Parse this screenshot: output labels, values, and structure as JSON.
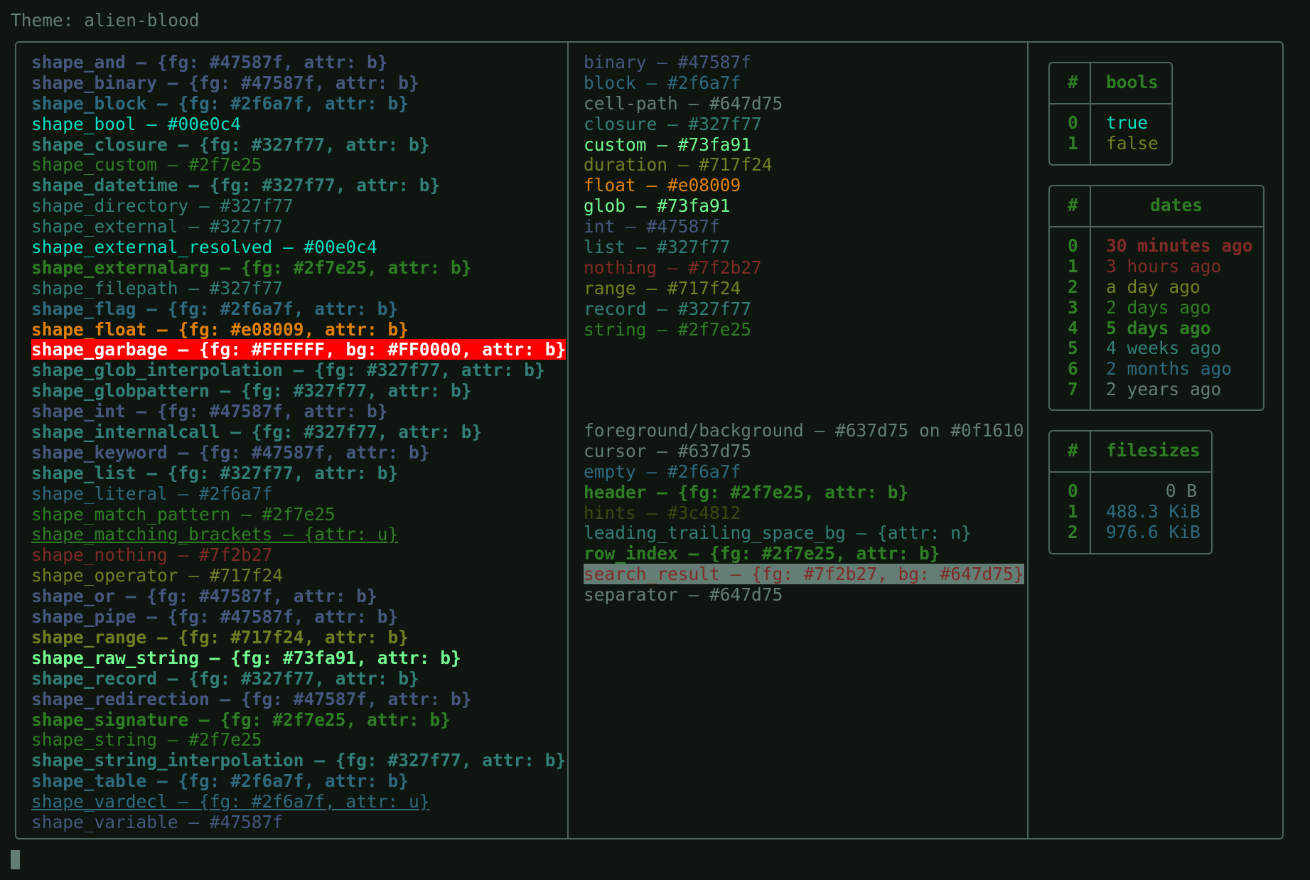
{
  "theme_line": "Theme: alien-blood",
  "shapes": [
    {
      "text": "shape_and – {fg: #47587f, attr: b}",
      "fg": "#47587f",
      "bold": true
    },
    {
      "text": "shape_binary – {fg: #47587f, attr: b}",
      "fg": "#47587f",
      "bold": true
    },
    {
      "text": "shape_block – {fg: #2f6a7f, attr: b}",
      "fg": "#2f6a7f",
      "bold": true
    },
    {
      "text": "shape_bool – #00e0c4",
      "fg": "#00e0c4"
    },
    {
      "text": "shape_closure – {fg: #327f77, attr: b}",
      "fg": "#327f77",
      "bold": true
    },
    {
      "text": "shape_custom – #2f7e25",
      "fg": "#2f7e25"
    },
    {
      "text": "shape_datetime – {fg: #327f77, attr: b}",
      "fg": "#327f77",
      "bold": true
    },
    {
      "text": "shape_directory – #327f77",
      "fg": "#327f77"
    },
    {
      "text": "shape_external – #327f77",
      "fg": "#327f77"
    },
    {
      "text": "shape_external_resolved – #00e0c4",
      "fg": "#00e0c4"
    },
    {
      "text": "shape_externalarg – {fg: #2f7e25, attr: b}",
      "fg": "#2f7e25",
      "bold": true
    },
    {
      "text": "shape_filepath – #327f77",
      "fg": "#327f77"
    },
    {
      "text": "shape_flag – {fg: #2f6a7f, attr: b}",
      "fg": "#2f6a7f",
      "bold": true
    },
    {
      "text": "shape_float – {fg: #e08009, attr: b}",
      "fg": "#e08009",
      "bold": true
    },
    {
      "text": "shape_garbage – {fg: #FFFFFF, bg: #FF0000, attr: b}",
      "fg": "#FFFFFF",
      "bg": "#FF0000",
      "bold": true
    },
    {
      "text": "shape_glob_interpolation – {fg: #327f77, attr: b}",
      "fg": "#327f77",
      "bold": true
    },
    {
      "text": "shape_globpattern – {fg: #327f77, attr: b}",
      "fg": "#327f77",
      "bold": true
    },
    {
      "text": "shape_int – {fg: #47587f, attr: b}",
      "fg": "#47587f",
      "bold": true
    },
    {
      "text": "shape_internalcall – {fg: #327f77, attr: b}",
      "fg": "#327f77",
      "bold": true
    },
    {
      "text": "shape_keyword – {fg: #47587f, attr: b}",
      "fg": "#47587f",
      "bold": true
    },
    {
      "text": "shape_list – {fg: #327f77, attr: b}",
      "fg": "#327f77",
      "bold": true
    },
    {
      "text": "shape_literal – #2f6a7f",
      "fg": "#2f6a7f"
    },
    {
      "text": "shape_match_pattern – #2f7e25",
      "fg": "#2f7e25"
    },
    {
      "text": "shape_matching_brackets – {attr: u}",
      "fg": "#2f7e25",
      "underline": true
    },
    {
      "text": "shape_nothing – #7f2b27",
      "fg": "#7f2b27"
    },
    {
      "text": "shape_operator – #717f24",
      "fg": "#717f24"
    },
    {
      "text": "shape_or – {fg: #47587f, attr: b}",
      "fg": "#47587f",
      "bold": true
    },
    {
      "text": "shape_pipe – {fg: #47587f, attr: b}",
      "fg": "#47587f",
      "bold": true
    },
    {
      "text": "shape_range – {fg: #717f24, attr: b}",
      "fg": "#717f24",
      "bold": true
    },
    {
      "text": "shape_raw_string – {fg: #73fa91, attr: b}",
      "fg": "#73fa91",
      "bold": true
    },
    {
      "text": "shape_record – {fg: #327f77, attr: b}",
      "fg": "#327f77",
      "bold": true
    },
    {
      "text": "shape_redirection – {fg: #47587f, attr: b}",
      "fg": "#47587f",
      "bold": true
    },
    {
      "text": "shape_signature – {fg: #2f7e25, attr: b}",
      "fg": "#2f7e25",
      "bold": true
    },
    {
      "text": "shape_string – #2f7e25",
      "fg": "#2f7e25"
    },
    {
      "text": "shape_string_interpolation – {fg: #327f77, attr: b}",
      "fg": "#327f77",
      "bold": true
    },
    {
      "text": "shape_table – {fg: #2f6a7f, attr: b}",
      "fg": "#2f6a7f",
      "bold": true
    },
    {
      "text": "shape_vardecl – {fg: #2f6a7f, attr: u}",
      "fg": "#2f6a7f",
      "underline": true
    },
    {
      "text": "shape_variable – #47587f",
      "fg": "#47587f"
    }
  ],
  "types": [
    {
      "text": "binary – #47587f",
      "fg": "#47587f"
    },
    {
      "text": "block – #2f6a7f",
      "fg": "#2f6a7f"
    },
    {
      "text": "cell-path – #647d75",
      "fg": "#647d75"
    },
    {
      "text": "closure – #327f77",
      "fg": "#327f77"
    },
    {
      "text": "custom – #73fa91",
      "fg": "#73fa91"
    },
    {
      "text": "duration – #717f24",
      "fg": "#717f24"
    },
    {
      "text": "float – #e08009",
      "fg": "#e08009"
    },
    {
      "text": "glob – #73fa91",
      "fg": "#73fa91"
    },
    {
      "text": "int – #47587f",
      "fg": "#47587f"
    },
    {
      "text": "list – #327f77",
      "fg": "#327f77"
    },
    {
      "text": "nothing – #7f2b27",
      "fg": "#7f2b27"
    },
    {
      "text": "range – #717f24",
      "fg": "#717f24"
    },
    {
      "text": "record – #327f77",
      "fg": "#327f77"
    },
    {
      "text": "string – #2f7e25",
      "fg": "#2f7e25"
    }
  ],
  "ui": [
    {
      "text": "foreground/background – #637d75 on #0f1610",
      "fg": "#637d75"
    },
    {
      "text": "cursor – #637d75",
      "fg": "#637d75"
    },
    {
      "text": "empty – #2f6a7f",
      "fg": "#2f6a7f"
    },
    {
      "text": "header – {fg: #2f7e25, attr: b}",
      "fg": "#2f7e25",
      "bold": true
    },
    {
      "text": "hints – #3c4812",
      "fg": "#3c4812"
    },
    {
      "text": "leading_trailing_space_bg – {attr: n}",
      "fg": "#327f77"
    },
    {
      "text": "row_index – {fg: #2f7e25, attr: b}",
      "fg": "#2f7e25",
      "bold": true
    },
    {
      "text": "search_result – {fg: #7f2b27, bg: #647d75}",
      "fg": "#7f2b27",
      "bg": "#647d75"
    },
    {
      "text": "separator – #647d75",
      "fg": "#647d75"
    }
  ],
  "tables": {
    "bools": {
      "index_header": "#",
      "header": "bools",
      "rows": [
        {
          "index": "0",
          "value": "true",
          "fg": "#00e0c4"
        },
        {
          "index": "1",
          "value": "false",
          "fg": "#717f24"
        }
      ]
    },
    "dates": {
      "index_header": "#",
      "header": "dates",
      "rows": [
        {
          "index": "0",
          "value": "30 minutes ago",
          "fg": "#7f2b27",
          "bold": true
        },
        {
          "index": "1",
          "value": "3 hours ago",
          "fg": "#7f2b27"
        },
        {
          "index": "2",
          "value": "a day ago",
          "fg": "#717f24"
        },
        {
          "index": "3",
          "value": "2 days ago",
          "fg": "#2f7e25"
        },
        {
          "index": "4",
          "value": "5 days ago",
          "fg": "#2f7e25",
          "bold": true
        },
        {
          "index": "5",
          "value": "4 weeks ago",
          "fg": "#327f77"
        },
        {
          "index": "6",
          "value": "2 months ago",
          "fg": "#2f6a7f"
        },
        {
          "index": "7",
          "value": "2 years ago",
          "fg": "#637d75"
        }
      ]
    },
    "filesizes": {
      "index_header": "#",
      "header": "filesizes",
      "rows": [
        {
          "index": "0",
          "value": "0 B",
          "fg": "#637d75"
        },
        {
          "index": "1",
          "value": "488.3 KiB",
          "fg": "#2f6a7f"
        },
        {
          "index": "2",
          "value": "976.6 KiB",
          "fg": "#2f6a7f"
        }
      ]
    }
  }
}
